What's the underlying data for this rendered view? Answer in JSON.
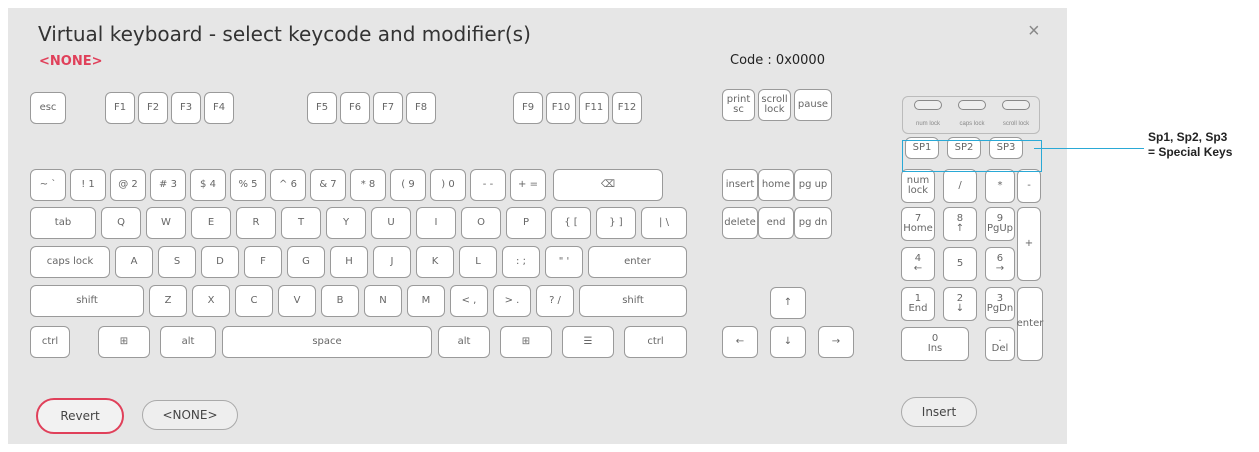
{
  "dialog": {
    "title": "Virtual keyboard - select keycode and modifier(s)",
    "close_label": "×",
    "selection": "<NONE>",
    "code": "Code : 0x0000"
  },
  "keyboard": {
    "function_row": [
      "esc",
      "F1",
      "F2",
      "F3",
      "F4",
      "F5",
      "F6",
      "F7",
      "F8",
      "F9",
      "F10",
      "F11",
      "F12"
    ],
    "system_keys": [
      "print\nsc",
      "scroll\nlock",
      "pause"
    ],
    "number_row": [
      "~ `",
      "! 1",
      "@ 2",
      "# 3",
      "$ 4",
      "% 5",
      "^ 6",
      "& 7",
      "* 8",
      "( 9",
      ") 0",
      "- -",
      "+ =",
      "⌫"
    ],
    "qwerty_row": [
      "tab",
      "Q",
      "W",
      "E",
      "R",
      "T",
      "Y",
      "U",
      "I",
      "O",
      "P",
      "{ [",
      "} ]",
      "| \\"
    ],
    "home_row": [
      "caps lock",
      "A",
      "S",
      "D",
      "F",
      "G",
      "H",
      "J",
      "K",
      "L",
      ": ;",
      "\" '",
      "enter"
    ],
    "shift_row": [
      "shift",
      "Z",
      "X",
      "C",
      "V",
      "B",
      "N",
      "M",
      "< ,",
      "> .",
      "? /",
      "shift"
    ],
    "bottom_row": [
      "ctrl",
      "⊞",
      "alt",
      "space",
      "alt",
      "⊞",
      "☰",
      "ctrl"
    ],
    "nav_keys": [
      "insert",
      "home",
      "pg up",
      "delete",
      "end",
      "pg dn"
    ],
    "arrow_keys": [
      "↑",
      "←",
      "↓",
      "→"
    ],
    "indicators": [
      "num lock",
      "caps lock",
      "scroll lock"
    ],
    "special_keys": [
      "SP1",
      "SP2",
      "SP3"
    ],
    "numpad": [
      "num\nlock",
      "/",
      "*",
      "-",
      "7\nHome",
      "8\n↑",
      "9\nPgUp",
      "+",
      "4\n←",
      "5",
      "6\n→",
      "1\nEnd",
      "2\n↓",
      "3\nPgDn",
      "enter",
      "0\nIns",
      ".\nDel"
    ]
  },
  "buttons": {
    "revert": "Revert",
    "none": "<NONE>",
    "insert": "Insert"
  },
  "annotation": {
    "line1": "Sp1, Sp2, Sp3",
    "line2": "= Special Keys"
  },
  "colors": {
    "accent": "#e0405a",
    "highlight": "#2aa9d6"
  }
}
